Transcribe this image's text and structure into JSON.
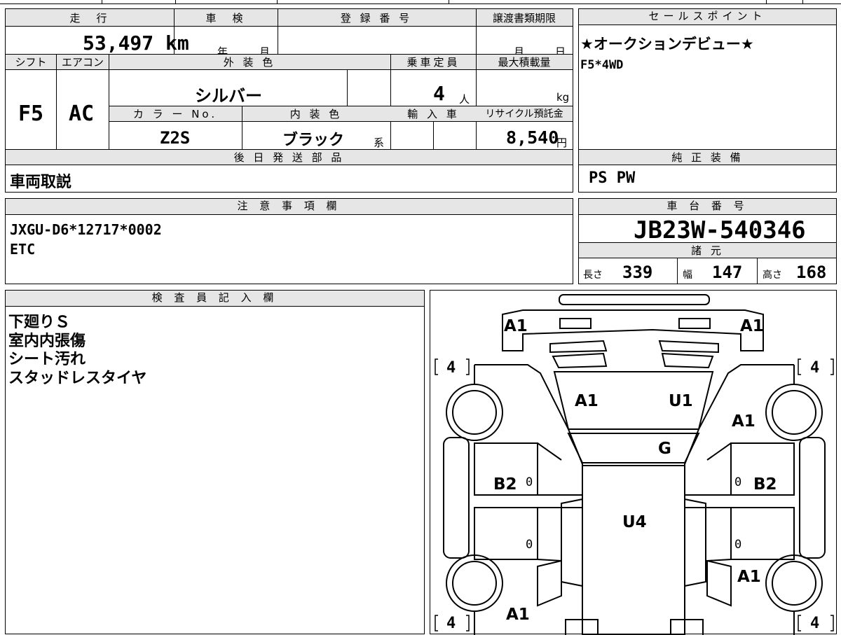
{
  "mileage": {
    "label": "走　行",
    "value": "53,497 km"
  },
  "inspection": {
    "label": "車　検",
    "year_unit": "年",
    "month_unit": "月"
  },
  "registration_no": {
    "label": "登 録 番 号"
  },
  "transfer_deadline": {
    "label": "譲渡書類期限",
    "month_unit": "月",
    "day_unit": "日"
  },
  "shift": {
    "label": "シフト",
    "value": "F5"
  },
  "aircon": {
    "label": "エアコン",
    "value": "AC"
  },
  "exterior_color": {
    "label": "外 装 色",
    "value": "シルバー"
  },
  "capacity": {
    "label": "乗車定員",
    "value": "4",
    "unit": "人"
  },
  "max_load": {
    "label": "最大積載量",
    "unit": "kg"
  },
  "color_no": {
    "label": "カ ラ ー No.",
    "value": "Z2S"
  },
  "interior_color": {
    "label": "内 装 色",
    "value": "ブラック",
    "suffix": "系"
  },
  "import_car": {
    "label": "輸 入 車"
  },
  "recycle_fee": {
    "label": "リサイクル預託金",
    "value": "8,540",
    "unit": "円"
  },
  "later_parts": {
    "label": "後 日 発 送 部 品",
    "value": "車両取説"
  },
  "notes": {
    "label": "注 意 事 項 欄",
    "lines": [
      "JXGU-D6*12717*0002",
      "ETC"
    ]
  },
  "sales_points": {
    "label": "セールスポイント",
    "lines": [
      "★オークションデビュー★",
      "F5*4WD"
    ]
  },
  "standard_equipment": {
    "label": "純 正 装 備",
    "value": "PS PW"
  },
  "chassis_no": {
    "label": "車 台 番 号",
    "value": "JB23W-540346"
  },
  "specs": {
    "label": "諸 元",
    "length_label": "長さ",
    "length": "339",
    "width_label": "幅",
    "width": "147",
    "height_label": "高さ",
    "height": "168"
  },
  "inspector": {
    "label": "検 査 員 記 入 欄",
    "lines": [
      "下廻りＳ",
      "室内内張傷",
      "シート汚れ",
      "スタッドレスタイヤ"
    ]
  },
  "diagram": {
    "codes": {
      "front_left_corner": "A1",
      "front_right_corner": "A1",
      "hood_left": "A1",
      "hood_right": "U1",
      "right_front_fender": "A1",
      "windshield": "G",
      "left_door": "B2",
      "right_door": "B2",
      "roof": "U4",
      "rear_right_fender": "A1",
      "rear_left": "A1"
    },
    "treads": {
      "front_left": "4",
      "front_right": "4",
      "rear_left": "4",
      "rear_right": "4"
    },
    "door_depth": {
      "lf": "0",
      "lr": "0",
      "rf": "0",
      "rr": "0"
    }
  }
}
